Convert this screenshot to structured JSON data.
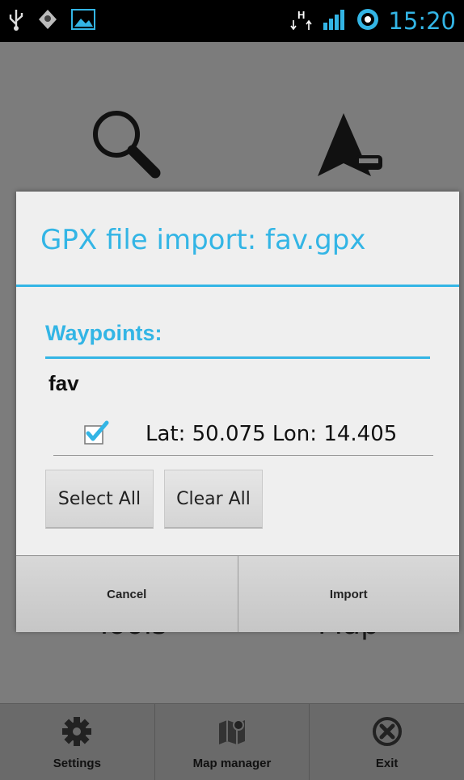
{
  "status_bar": {
    "time": "15:20",
    "left_icons": [
      "usb-icon",
      "location-icon",
      "image-icon"
    ],
    "right_icons": [
      "data-h-icon",
      "signal-icon",
      "battery-icon"
    ],
    "accent": "#33b5e5"
  },
  "background_menu": {
    "items": [
      {
        "label": "Tools",
        "icon": "search-icon"
      },
      {
        "label": "Map",
        "icon": "navigation-arrow-icon"
      }
    ]
  },
  "dialog": {
    "title": "GPX file import: fav.gpx",
    "section_label": "Waypoints:",
    "group_name": "fav",
    "waypoints": [
      {
        "checked": true,
        "text": "Lat: 50.075  Lon: 14.405"
      }
    ],
    "select_all_label": "Select All",
    "clear_all_label": "Clear All",
    "cancel_label": "Cancel",
    "import_label": "Import"
  },
  "bottom_bar": {
    "items": [
      {
        "label": "Settings",
        "icon": "gear-icon"
      },
      {
        "label": "Map manager",
        "icon": "map-icon"
      },
      {
        "label": "Exit",
        "icon": "close-circle-icon"
      }
    ]
  }
}
